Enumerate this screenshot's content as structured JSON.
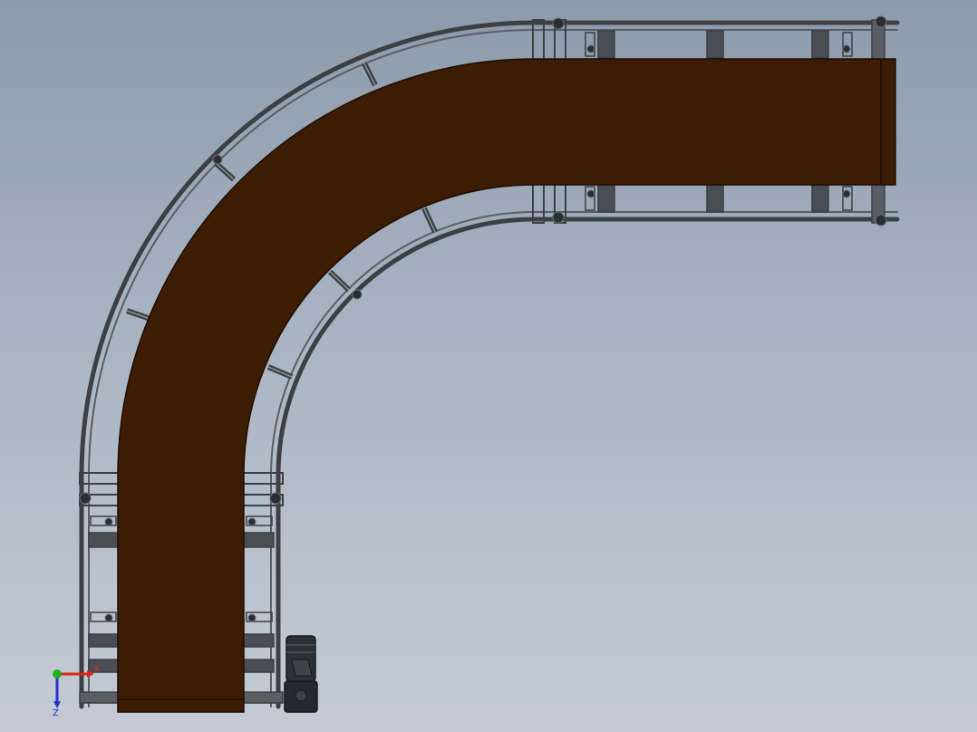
{
  "colors": {
    "background_top": "#8c9aab",
    "background_bottom": "#c4cbd4",
    "belt": "#3d1c04",
    "belt_edge": "#2a1202",
    "frame": "#3c3f44",
    "frame_light": "#6a6f76",
    "motor": "#2d3034",
    "axis_x": "#e0261b",
    "axis_y": "#22b022",
    "axis_z": "#2533c8"
  },
  "triad": {
    "x_label": "X",
    "z_label": "Z",
    "icon": "coordinate-triad-icon"
  },
  "model": {
    "type": "curved-belt-conveyor",
    "curve_angle_deg": 90,
    "has_drive_motor": true
  }
}
